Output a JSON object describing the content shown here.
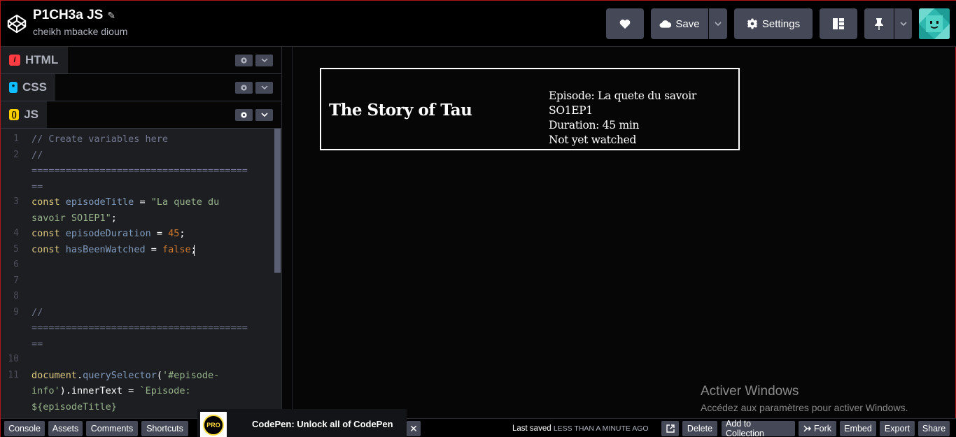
{
  "header": {
    "pen_title": "P1CH3a JS",
    "author": "cheikh mbacke dioum",
    "save_label": "Save",
    "settings_label": "Settings"
  },
  "editors": {
    "html_label": "HTML",
    "css_label": "CSS",
    "js_label": "JS"
  },
  "code": {
    "line_numbers": [
      "1",
      "2",
      "3",
      "4",
      "5",
      "6",
      "7",
      "8",
      "9",
      "10",
      "11"
    ],
    "l1": "// Create variables here",
    "l2a": "//",
    "l2b": "======================================",
    "l2c": "==",
    "l3a_kw": "const",
    "l3a_def": "episodeTitle",
    "l3a_op": " = ",
    "l3a_str": "\"La quete du",
    "l3b_str": "savoir SO1EP1\"",
    "l3b_end": ";",
    "l4_kw": "const",
    "l4_def": "episodeDuration",
    "l4_op": " = ",
    "l4_num": "45",
    "l4_end": ";",
    "l5_kw": "const",
    "l5_def": "hasBeenWatched",
    "l5_op": " = ",
    "l5_atom": "false",
    "l5_end": ";",
    "l9a": "//",
    "l9b": "======================================",
    "l9c": "==",
    "l11a_obj": "document",
    "l11a_dot": ".",
    "l11a_fn": "querySelector",
    "l11a_p": "(",
    "l11a_str": "'#episode-",
    "l11b_str": "info'",
    "l11b_rest": ").innerText = ",
    "l11b_tpl": "`Episode:",
    "l11c": "${episodeTitle}"
  },
  "preview": {
    "show_title": "The Story of Tau",
    "episode_line": "Episode: La quete du savoir SO1EP1",
    "duration_line": "Duration: 45 min",
    "watched_line": "Not yet watched",
    "watermark_title": "Activer Windows",
    "watermark_sub": "Accédez aux paramètres pour activer Windows."
  },
  "footer": {
    "console": "Console",
    "assets": "Assets",
    "comments": "Comments",
    "shortcuts": "Shortcuts",
    "promo_badge": "PRO",
    "promo_text": "CodePen: Unlock all of CodePen",
    "promo_close": "✕",
    "last_saved_label": "Last saved",
    "last_saved_time": "LESS THAN A MINUTE AGO",
    "delete": "Delete",
    "add_to_collection": "Add to Collection",
    "fork": "Fork",
    "embed": "Embed",
    "export": "Export",
    "share": "Share"
  },
  "colors": {
    "html_icon": "#ff3c41",
    "css_icon": "#0ebeff",
    "js_icon": "#fcd000",
    "button_bg": "#444857"
  }
}
